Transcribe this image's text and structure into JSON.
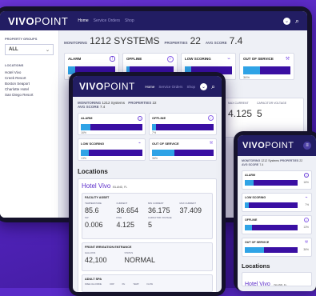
{
  "brand": {
    "logo_bold": "VIVO",
    "logo_light": "POINT"
  },
  "nav": {
    "home": "Home",
    "service_orders": "Service Orders",
    "shop": "Shop"
  },
  "desktop": {
    "stats": {
      "monitoring_label": "MONITORING",
      "monitoring_value": "1212 SYSTEMS",
      "properties_label": "PROPERTIES",
      "properties_value": "22",
      "avg_label": "AVG SCORE",
      "avg_value": "7.4"
    },
    "sidebar": {
      "group_label": "PROPERTY GROUPS",
      "group_value": "ALL",
      "locations_label": "LOCATIONS",
      "locations": [
        "Hotel Vivo",
        "Creek Resort",
        "Boston Seaport",
        "Charlotte Hotel",
        "San Diego Resort"
      ]
    },
    "cards": [
      {
        "title": "ALARM",
        "pct": "16%",
        "value": 0.16
      },
      {
        "title": "OFFLINE",
        "pct": "7%",
        "value": 0.07
      },
      {
        "title": "LOW SCORING",
        "pct": "13%",
        "value": 0.13
      },
      {
        "title": "OUT OF SERVICE",
        "pct": "36%",
        "value": 0.36
      }
    ],
    "partial": {
      "c1": "MAX CURRENT",
      "c2": "CAPACITOR VOLTAGE",
      "v1": "4.125",
      "v2": "5"
    }
  },
  "tablet": {
    "stats": {
      "monitoring_label": "MONITORING",
      "monitoring_value": "1212 Systems",
      "properties_label": "PROPERTIES",
      "properties_value": "22",
      "avg_label": "AVG SCORE",
      "avg_value": "7.4"
    },
    "cards": [
      {
        "title": "ALARM",
        "pct": "16%",
        "value": 0.16
      },
      {
        "title": "OFFLINE",
        "pct": "7%",
        "value": 0.07
      },
      {
        "title": "LOW SCORING",
        "pct": "13%",
        "value": 0.13
      },
      {
        "title": "OUT OF SERVICE",
        "pct": "36%",
        "value": 0.36
      }
    ],
    "locations_title": "Locations",
    "hotel": "Hotel Vivo",
    "hotel_sub": "ISLAND, FL",
    "facility": {
      "title": "FACILITY ASSET",
      "h": [
        "TEMPERATURE",
        "CURRENT",
        "MIN CURRENT",
        "MAX CURRENT"
      ],
      "v": [
        "85.6",
        "36.654",
        "36.175",
        "37.409"
      ],
      "h2": [
        "KW",
        "KWH",
        "CAPACITOR VOLTAGE"
      ],
      "v2": [
        "0.006",
        "4.125",
        "5"
      ]
    },
    "fountain": {
      "title": "FRONT IRRIGATION ENTRANCE",
      "h": [
        "GALLONS",
        "STATUS"
      ],
      "v": [
        "42,100",
        "NORMAL"
      ]
    },
    "spa": {
      "title": "ADULT SPA",
      "h": [
        "FREE CHLORINE",
        "ORP",
        "PH",
        "TEMP",
        "FLOW"
      ]
    }
  },
  "phone": {
    "stats": {
      "monitoring_label": "MONITORING",
      "monitoring_value": "1212 Systems",
      "properties_label": "PROPERTIES",
      "properties_value": "22",
      "avg_label": "AVG SCORE",
      "avg_value": "7.4"
    },
    "cards": [
      {
        "title": "ALARM",
        "pct": "16%",
        "value": 0.16
      },
      {
        "title": "LOW SCORING",
        "pct": "7%",
        "value": 0.07
      },
      {
        "title": "OFFLINE",
        "pct": "13%",
        "value": 0.13
      },
      {
        "title": "OUT OF SERVICE",
        "pct": "36%",
        "value": 0.36
      }
    ],
    "locations_title": "Locations",
    "hotel": "Hotel Vivo",
    "hotel_sub": "ISLAND, FL"
  },
  "colors": {
    "header": "#221d63",
    "bar": "#3a0fa3",
    "fill": "#2fa3e6",
    "badge_alarm": "#6d43d9",
    "badge_offline": "#8a63e8"
  }
}
